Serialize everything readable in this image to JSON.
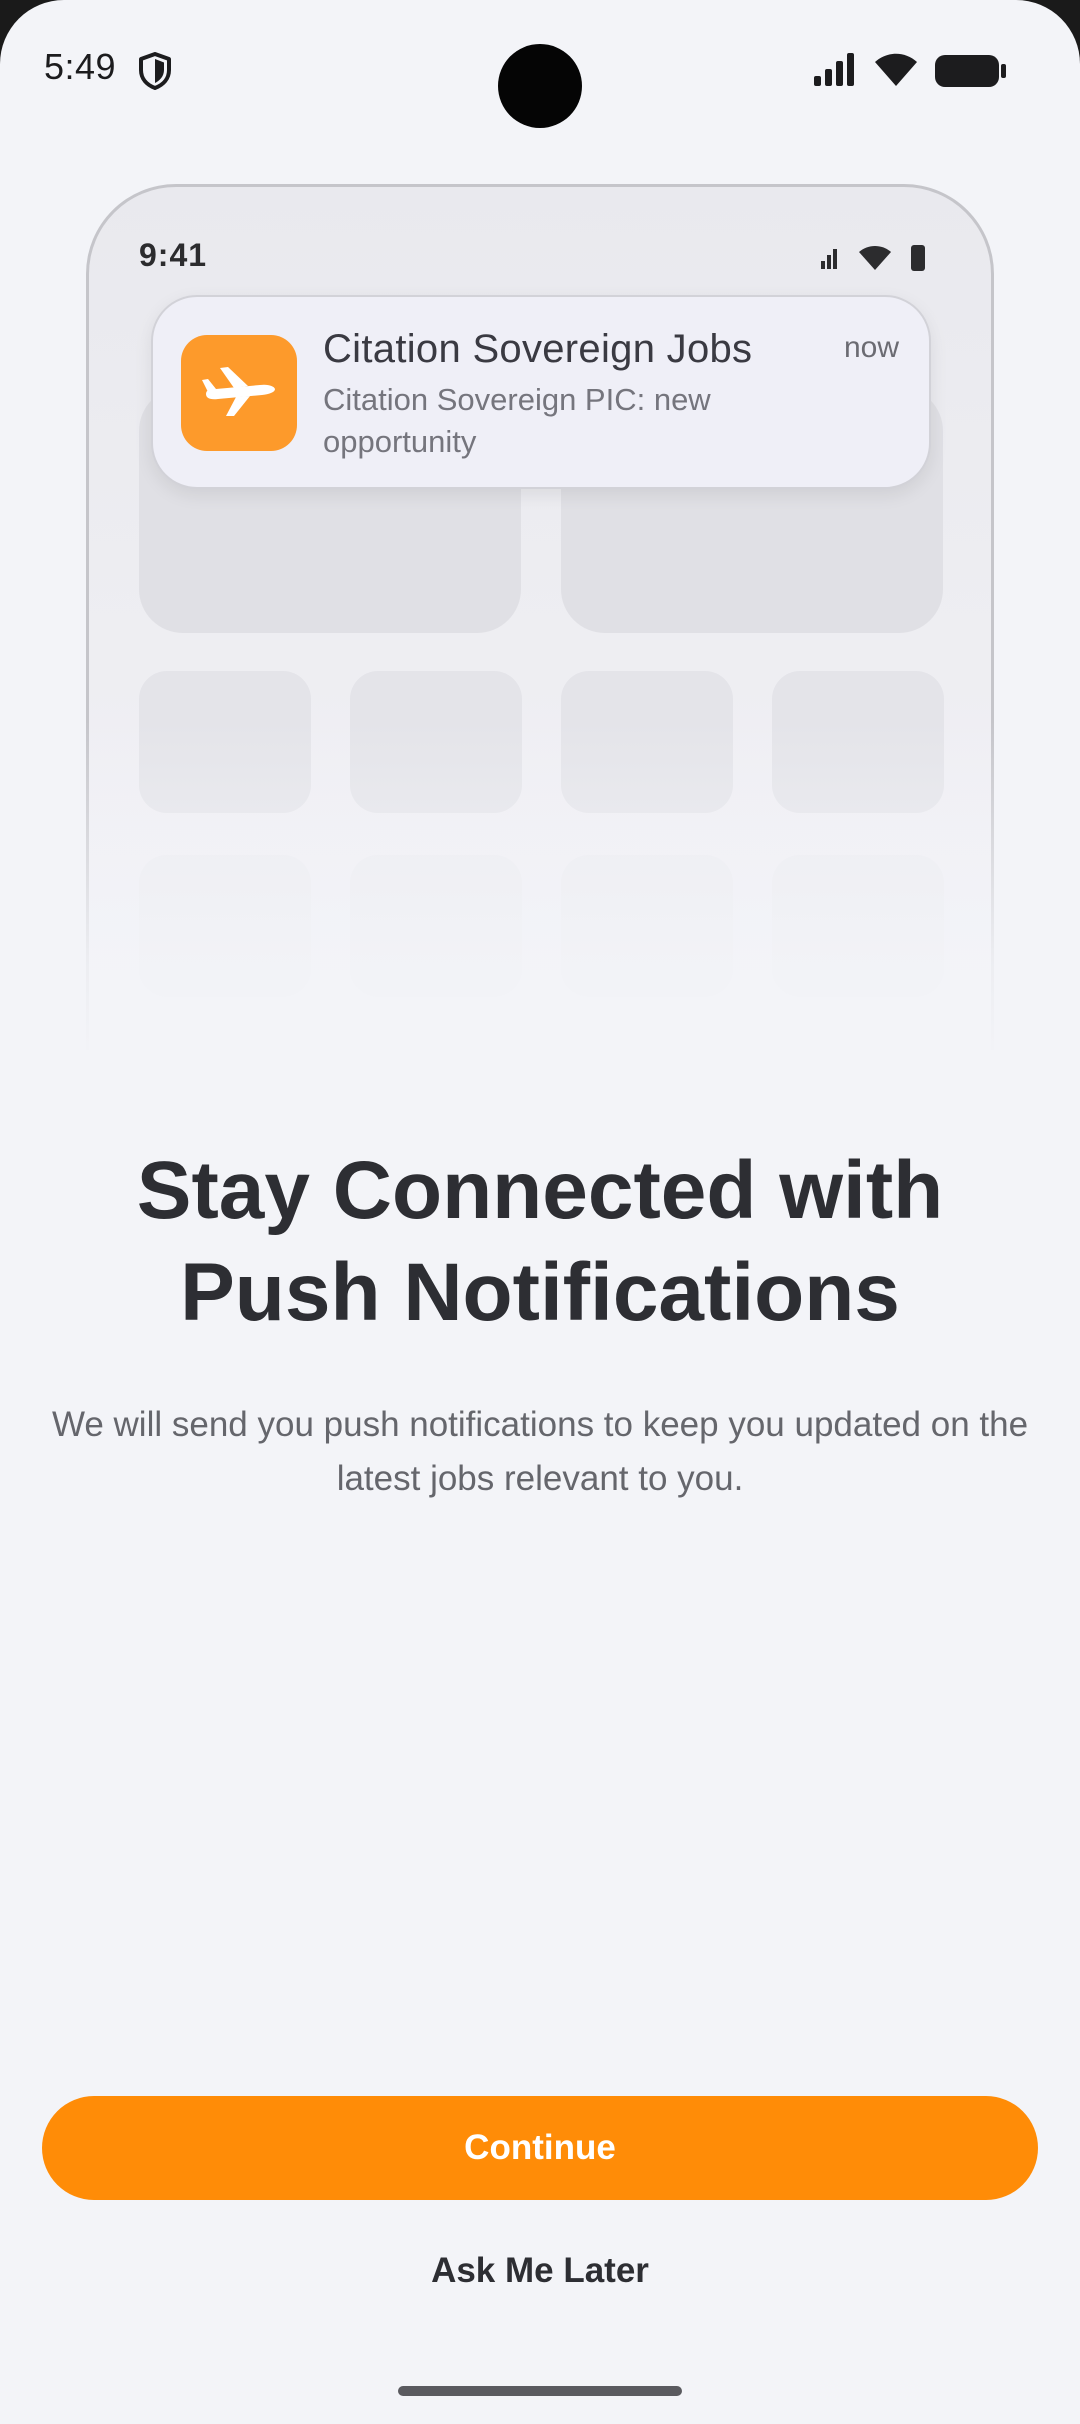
{
  "status_bar": {
    "time": "5:49",
    "icons": [
      "shield-icon",
      "signal-icon",
      "wifi-icon",
      "battery-icon"
    ]
  },
  "mockup": {
    "time": "9:41",
    "notification": {
      "app_name": "Citation Sovereign Jobs",
      "time": "now",
      "message": "Citation Sovereign PIC: new opportunity",
      "icon": "airplane-icon",
      "icon_color": "#fd9a2b"
    }
  },
  "content": {
    "headline": "Stay Connected with Push Notifications",
    "subtitle": "We will send you push notifications to keep you updated on the latest jobs relevant to you."
  },
  "actions": {
    "continue_label": "Continue",
    "later_label": "Ask Me Later"
  },
  "colors": {
    "accent": "#ff8c07",
    "background": "#f3f4f8",
    "text_primary": "#2d2e33",
    "text_secondary": "#65666c"
  }
}
